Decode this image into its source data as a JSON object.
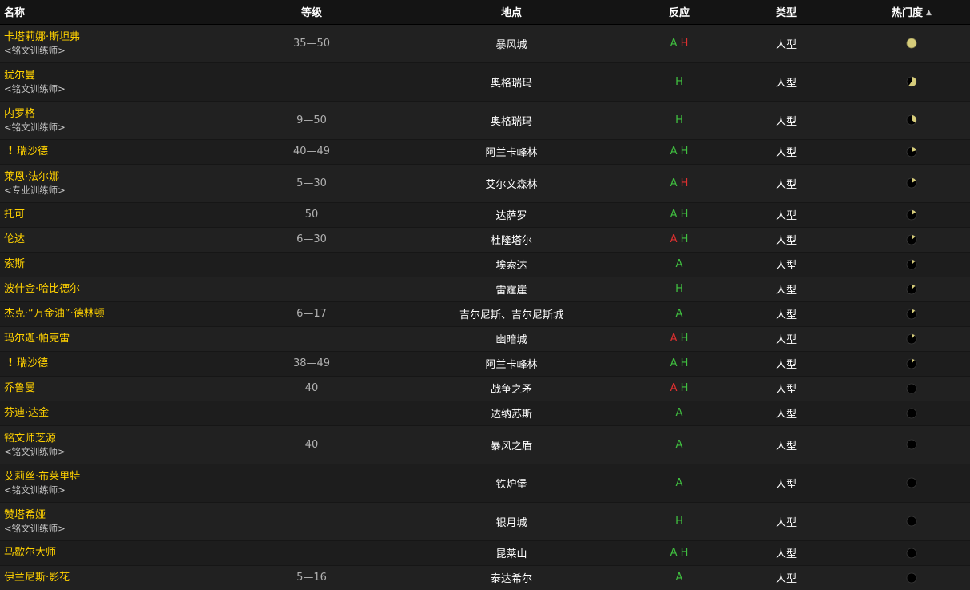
{
  "columns": {
    "name": "名称",
    "level": "等级",
    "location": "地点",
    "react": "反应",
    "type": "类型",
    "popularity": "热门度",
    "sort_indicator": "▲"
  },
  "colors": {
    "name_link": "#ffd100",
    "react_friendly": "#40c040",
    "react_hostile": "#e03030",
    "pie_fill": "#d6cc7a",
    "pie_bg": "#000000"
  },
  "rows": [
    {
      "name": "卡塔莉娜·斯坦弗",
      "subtitle": "<铭文训练师>",
      "level": "35—50",
      "location": "暴风城",
      "react": [
        {
          "t": "A",
          "c": "green"
        },
        {
          "t": "H",
          "c": "red"
        }
      ],
      "type": "人型",
      "popularity": 1.0,
      "quest": false,
      "tall": true
    },
    {
      "name": "犹尔曼",
      "subtitle": "<铭文训练师>",
      "level": "",
      "location": "奥格瑞玛",
      "react": [
        {
          "t": "H",
          "c": "green"
        }
      ],
      "type": "人型",
      "popularity": 0.6,
      "quest": false,
      "tall": true
    },
    {
      "name": "内罗格",
      "subtitle": "<铭文训练师>",
      "level": "9—50",
      "location": "奥格瑞玛",
      "react": [
        {
          "t": "H",
          "c": "green"
        }
      ],
      "type": "人型",
      "popularity": 0.35,
      "quest": false,
      "tall": true
    },
    {
      "name": "瑞沙德",
      "subtitle": "",
      "level": "40—49",
      "location": "阿兰卡峰林",
      "react": [
        {
          "t": "A",
          "c": "green"
        },
        {
          "t": "H",
          "c": "green"
        }
      ],
      "type": "人型",
      "popularity": 0.2,
      "quest": true,
      "tall": false
    },
    {
      "name": "莱恩·法尔娜",
      "subtitle": "<专业训练师>",
      "level": "5—30",
      "location": "艾尔文森林",
      "react": [
        {
          "t": "A",
          "c": "green"
        },
        {
          "t": "H",
          "c": "red"
        }
      ],
      "type": "人型",
      "popularity": 0.17,
      "quest": false,
      "tall": true
    },
    {
      "name": "托可",
      "subtitle": "",
      "level": "50",
      "location": "达萨罗",
      "react": [
        {
          "t": "A",
          "c": "green"
        },
        {
          "t": "H",
          "c": "green"
        }
      ],
      "type": "人型",
      "popularity": 0.16,
      "quest": false,
      "tall": false
    },
    {
      "name": "伦达",
      "subtitle": "",
      "level": "6—30",
      "location": "杜隆塔尔",
      "react": [
        {
          "t": "A",
          "c": "red"
        },
        {
          "t": "H",
          "c": "green"
        }
      ],
      "type": "人型",
      "popularity": 0.14,
      "quest": false,
      "tall": false
    },
    {
      "name": "索斯",
      "subtitle": "",
      "level": "",
      "location": "埃索达",
      "react": [
        {
          "t": "A",
          "c": "green"
        }
      ],
      "type": "人型",
      "popularity": 0.13,
      "quest": false,
      "tall": false
    },
    {
      "name": "波什金·哈比德尔",
      "subtitle": "",
      "level": "",
      "location": "雷霆崖",
      "react": [
        {
          "t": "H",
          "c": "green"
        }
      ],
      "type": "人型",
      "popularity": 0.13,
      "quest": false,
      "tall": false
    },
    {
      "name": "杰克·“万金油”·德林顿",
      "subtitle": "",
      "level": "6—17",
      "location": "吉尔尼斯、吉尔尼斯城",
      "react": [
        {
          "t": "A",
          "c": "green"
        }
      ],
      "type": "人型",
      "popularity": 0.12,
      "quest": false,
      "tall": false
    },
    {
      "name": "玛尔迦·帕克雷",
      "subtitle": "",
      "level": "",
      "location": "幽暗城",
      "react": [
        {
          "t": "A",
          "c": "red"
        },
        {
          "t": "H",
          "c": "green"
        }
      ],
      "type": "人型",
      "popularity": 0.11,
      "quest": false,
      "tall": false
    },
    {
      "name": "瑞沙德",
      "subtitle": "",
      "level": "38—49",
      "location": "阿兰卡峰林",
      "react": [
        {
          "t": "A",
          "c": "green"
        },
        {
          "t": "H",
          "c": "green"
        }
      ],
      "type": "人型",
      "popularity": 0.1,
      "quest": true,
      "tall": false
    },
    {
      "name": "乔鲁曼",
      "subtitle": "",
      "level": "40",
      "location": "战争之矛",
      "react": [
        {
          "t": "A",
          "c": "red"
        },
        {
          "t": "H",
          "c": "green"
        }
      ],
      "type": "人型",
      "popularity": 0.0,
      "quest": false,
      "tall": false
    },
    {
      "name": "芬迪·达金",
      "subtitle": "",
      "level": "",
      "location": "达纳苏斯",
      "react": [
        {
          "t": "A",
          "c": "green"
        }
      ],
      "type": "人型",
      "popularity": 0.0,
      "quest": false,
      "tall": false
    },
    {
      "name": "铭文师芝源",
      "subtitle": "<铭文训练师>",
      "level": "40",
      "location": "暴风之盾",
      "react": [
        {
          "t": "A",
          "c": "green"
        }
      ],
      "type": "人型",
      "popularity": 0.0,
      "quest": false,
      "tall": true
    },
    {
      "name": "艾莉丝·布莱里特",
      "subtitle": "<铭文训练师>",
      "level": "",
      "location": "铁炉堡",
      "react": [
        {
          "t": "A",
          "c": "green"
        }
      ],
      "type": "人型",
      "popularity": 0.0,
      "quest": false,
      "tall": true
    },
    {
      "name": "赞塔希娅",
      "subtitle": "<铭文训练师>",
      "level": "",
      "location": "银月城",
      "react": [
        {
          "t": "H",
          "c": "green"
        }
      ],
      "type": "人型",
      "popularity": 0.0,
      "quest": false,
      "tall": true
    },
    {
      "name": "马歇尔大师",
      "subtitle": "",
      "level": "",
      "location": "昆莱山",
      "react": [
        {
          "t": "A",
          "c": "green"
        },
        {
          "t": "H",
          "c": "green"
        }
      ],
      "type": "人型",
      "popularity": 0.0,
      "quest": false,
      "tall": false
    },
    {
      "name": "伊兰尼斯·影花",
      "subtitle": "",
      "level": "5—16",
      "location": "泰达希尔",
      "react": [
        {
          "t": "A",
          "c": "green"
        }
      ],
      "type": "人型",
      "popularity": 0.0,
      "quest": false,
      "tall": false
    }
  ]
}
